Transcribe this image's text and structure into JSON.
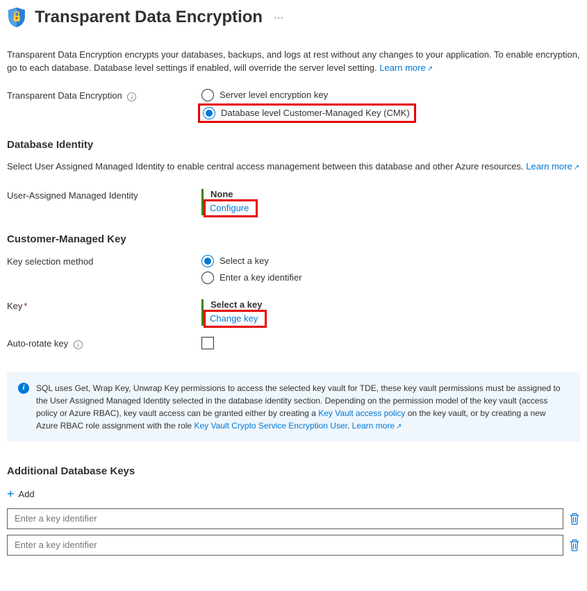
{
  "header": {
    "title": "Transparent Data Encryption"
  },
  "intro": {
    "text": "Transparent Data Encryption encrypts your databases, backups, and logs at rest without any changes to your application. To enable encryption, go to each database. Database level settings if enabled, will override the server level setting. ",
    "learn_more": "Learn more"
  },
  "tde": {
    "label": "Transparent Data Encryption",
    "option_server": "Server level encryption key",
    "option_db": "Database level Customer-Managed Key (CMK)"
  },
  "identity_section": {
    "heading": "Database Identity",
    "desc": "Select User Assigned Managed Identity to enable central access management between this database and other Azure resources. ",
    "learn_more": "Learn more",
    "field_label": "User-Assigned Managed Identity",
    "value": "None",
    "configure": "Configure"
  },
  "cmk_section": {
    "heading": "Customer-Managed Key",
    "method_label": "Key selection method",
    "method_select": "Select a key",
    "method_enter": "Enter a key identifier",
    "key_label": "Key",
    "key_value": "Select a key",
    "change_key": "Change key",
    "autorotate_label": "Auto-rotate key"
  },
  "info_panel": {
    "text_a": "SQL uses Get, Wrap Key, Unwrap Key permissions to access the selected key vault for TDE, these key vault permissions must be assigned to the User Assigned Managed Identity selected in the database identity section. Depending on the permission model of the key vault (access policy or Azure RBAC), key vault access can be granted either by creating a ",
    "link1": "Key Vault access policy",
    "text_b": " on the key vault, or by creating a new Azure RBAC role assignment with the role ",
    "link2": "Key Vault Crypto Service Encryption User",
    "text_c": ". ",
    "learn_more": "Learn more"
  },
  "additional": {
    "heading": "Additional Database Keys",
    "add_label": "Add",
    "placeholder": "Enter a key identifier"
  }
}
